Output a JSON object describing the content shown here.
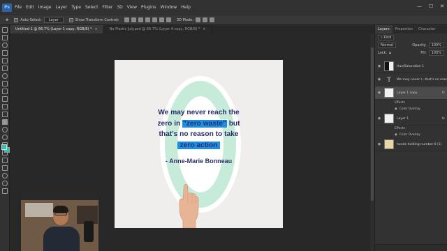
{
  "app": {
    "logo_text": "Ps"
  },
  "menu": [
    "File",
    "Edit",
    "Image",
    "Layer",
    "Type",
    "Select",
    "Filter",
    "3D",
    "View",
    "Plugins",
    "Window",
    "Help"
  ],
  "options_bar": {
    "auto_select_label": "Auto-Select:",
    "auto_select_value": "Layer",
    "transform_controls_label": "Show Transform Controls",
    "mode_label": "3D Mode:"
  },
  "tabs": [
    {
      "label": "Untitled-1 @ 66.7% (Layer 1 copy, RGB/8) *",
      "close": "×"
    },
    {
      "label": "No Plastic July.psd @ 66.7% (Layer 4 copy, RGB/8) *",
      "close": "×"
    }
  ],
  "canvas": {
    "quote_line1": "We may never reach the",
    "quote_line2_pre": "zero in ",
    "quote_line2_hl": "\"zero waste\"",
    "quote_line2_post": " but",
    "quote_line3": "that's no reason to take",
    "quote_line4_hl": "zero action",
    "author": "- Anne-Marie Bonneau"
  },
  "colors": {
    "foreground": "#2fc2ac",
    "background": "#2fc2ac",
    "highlight": "#1b8fe3",
    "quote_text": "#2d2d6e",
    "zero_fill": "#c6ecd9"
  },
  "panel": {
    "tabs": [
      "Layers",
      "Properties",
      "Character"
    ],
    "filter_label": "Kind",
    "blend_mode": "Normal",
    "opacity_label": "Opacity:",
    "opacity_value": "100%",
    "lock_label": "Lock:",
    "fill_label": "Fill:",
    "fill_value": "100%",
    "layers": [
      {
        "name": "Hue/Saturation 1",
        "type": "adjustment",
        "selected": false
      },
      {
        "name": "We may never r...that's no reas",
        "type": "text",
        "selected": false
      },
      {
        "name": "Layer 1 copy",
        "type": "pixel",
        "selected": true,
        "fx": "fx",
        "effects_label": "Effects",
        "effect": "Color Overlay"
      },
      {
        "name": "Layer 1",
        "type": "pixel",
        "selected": false,
        "fx": "fx",
        "effects_label": "Effects",
        "effect": "Color Overlay"
      },
      {
        "name": "hands-holding-number-0 (1)",
        "type": "image",
        "selected": false
      }
    ]
  },
  "watermark": "udemy"
}
